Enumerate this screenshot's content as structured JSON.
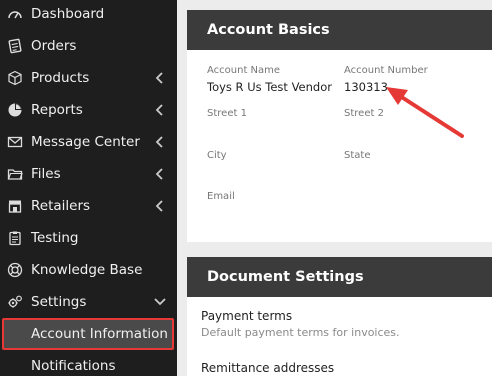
{
  "sidebar": {
    "items": [
      {
        "label": "Dashboard",
        "icon": "dashboard-gauge-icon"
      },
      {
        "label": "Orders",
        "icon": "orders-icon"
      },
      {
        "label": "Products",
        "icon": "cube-icon",
        "expandable": true
      },
      {
        "label": "Reports",
        "icon": "pie-chart-icon",
        "expandable": true
      },
      {
        "label": "Message Center",
        "icon": "envelope-icon",
        "expandable": true
      },
      {
        "label": "Files",
        "icon": "folder-icon",
        "expandable": true
      },
      {
        "label": "Retailers",
        "icon": "store-icon",
        "expandable": true
      },
      {
        "label": "Testing",
        "icon": "clipboard-icon"
      },
      {
        "label": "Knowledge Base",
        "icon": "life-ring-icon"
      },
      {
        "label": "Settings",
        "icon": "gears-icon",
        "expandable": true,
        "expanded": true
      }
    ],
    "sub_items": [
      {
        "label": "Account Information",
        "selected": true
      },
      {
        "label": "Notifications"
      }
    ]
  },
  "account_basics": {
    "title": "Account Basics",
    "account_name_label": "Account Name",
    "account_name_value": "Toys R Us Test Vendor",
    "account_number_label": "Account Number",
    "account_number_value": "130313",
    "street1_label": "Street 1",
    "street2_label": "Street 2",
    "city_label": "City",
    "state_label": "State",
    "email_label": "Email"
  },
  "document_settings": {
    "title": "Document Settings",
    "payment_terms_title": "Payment terms",
    "payment_terms_desc": "Default payment terms for invoices.",
    "remittance_title": "Remittance addresses"
  },
  "colors": {
    "sidebar_bg": "#1e1e1e",
    "card_header_bg": "#3b3b3b",
    "highlight_border": "#e53935",
    "arrow": "#e53935"
  }
}
